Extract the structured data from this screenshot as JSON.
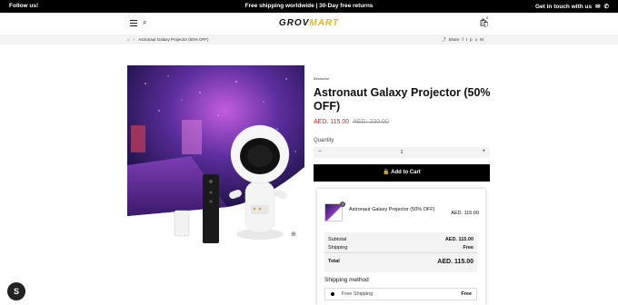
{
  "topbar": {
    "left": "Follow us!",
    "center": "Free shipping worldwide | 30-Day free returns",
    "right": "Get in touch with us",
    "mail_icon": "✉",
    "phone_icon": "✆"
  },
  "header": {
    "logo_part1": "GROV",
    "logo_part2": "MART",
    "menu_icon": "hamburger-menu",
    "search_icon": "⌕",
    "cart_icon": "🛍",
    "cart_count": "0"
  },
  "breadcrumb": {
    "home_icon": "⌂",
    "separator": "›",
    "current": "Astronaut Galaxy Projector (50% OFF)"
  },
  "share": {
    "label": "Share",
    "icons": [
      "f",
      "t",
      "p",
      "o",
      "M"
    ]
  },
  "product": {
    "badge": "Bestseller",
    "title": "Astronaut Galaxy Projector (50% OFF)",
    "sale_price": "AED. 115.00",
    "old_price": "AED. 230.00",
    "quantity_label": "Quantity",
    "quantity": "1",
    "minus": "−",
    "plus": "+",
    "add_to_cart": "Add to Cart",
    "cart_btn_icon": "🔒",
    "zoom_icon": "⊕"
  },
  "summary": {
    "item_name": "Astronaut Galaxy Projector (50% OFF)",
    "item_qty": "1",
    "item_price": "AED. 115.00",
    "subtotal_label": "Subtotal",
    "subtotal": "AED. 115.00",
    "shipping_label": "Shipping",
    "shipping": "Free",
    "total_label": "Total",
    "total": "AED. 115.00",
    "shipping_method_label": "Shipping method",
    "method_name": "Free Shipping",
    "method_price": "Free"
  },
  "colors": {
    "accent": "#e8b800",
    "sale": "#dd2222",
    "topbar": "#000000"
  }
}
